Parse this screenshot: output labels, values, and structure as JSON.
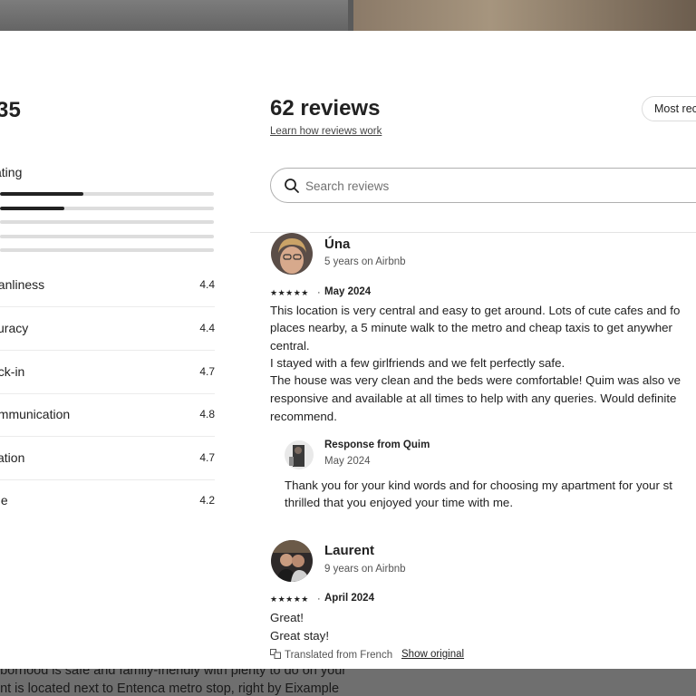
{
  "background": {
    "lines": [
      "nborhood is safe and family-friendly with plenty to do on your",
      "ent is located next to Entenca metro stop, right by Eixample"
    ]
  },
  "ratings": {
    "overall": "35",
    "overall_rating_label": "ating",
    "distribution": [
      0.39,
      0.3,
      0.0,
      0.0,
      0.0
    ],
    "categories": [
      {
        "name": "eanliness",
        "value": "4.4"
      },
      {
        "name": "curacy",
        "value": "4.4"
      },
      {
        "name": "eck-in",
        "value": "4.7"
      },
      {
        "name": "ommunication",
        "value": "4.8"
      },
      {
        "name": "cation",
        "value": "4.7"
      },
      {
        "name": "lue",
        "value": "4.2"
      }
    ]
  },
  "header": {
    "title": "62 reviews",
    "learn_link": "Learn how reviews work",
    "sort_label": "Most rec"
  },
  "search": {
    "placeholder": "Search reviews",
    "icon": "search-icon"
  },
  "reviews": [
    {
      "author": "Úna",
      "tenure": "5 years on Airbnb",
      "stars": "★★★★★",
      "date": "May 2024",
      "lines": [
        "This location is very central and easy to get around. Lots of cute cafes and fo",
        "places nearby, a 5 minute walk to the metro and cheap taxis to get anywher",
        "central.",
        "I stayed with a few girlfriends and we felt perfectly safe.",
        "The house was very clean and the beds were comfortable! Quim was also ve",
        "responsive and available at all times to help with any queries. Would definite",
        "recommend."
      ],
      "response": {
        "title": "Response from Quim",
        "date": "May 2024",
        "lines": [
          "Thank you for your kind words and for choosing my apartment for your st",
          "thrilled that you enjoyed your time with me."
        ]
      }
    },
    {
      "author": "Laurent",
      "tenure": "9 years on Airbnb",
      "stars": "★★★★★",
      "date": "April 2024",
      "lines": [
        "Great!",
        "Great stay!"
      ],
      "translated_label": "Translated from French",
      "show_original": "Show original"
    }
  ],
  "separator": "·"
}
